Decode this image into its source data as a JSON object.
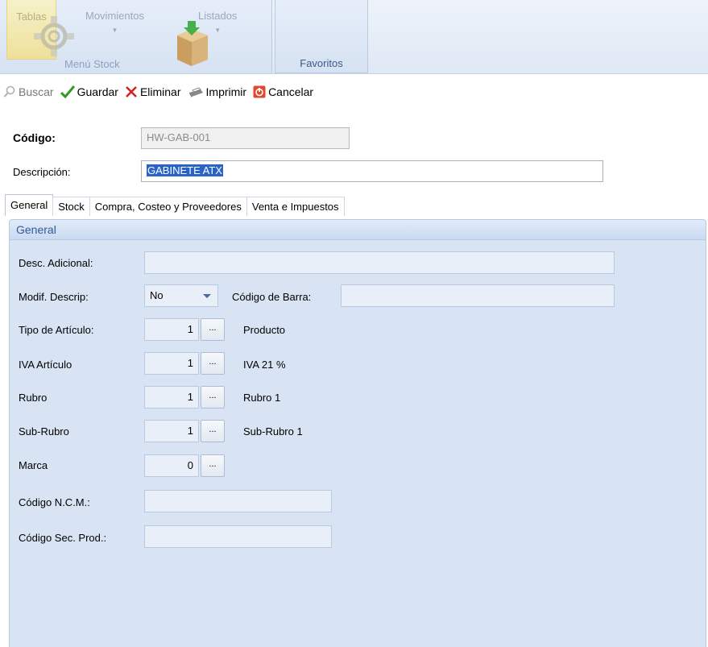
{
  "ribbon": {
    "tablas_label": "Tablas",
    "movimientos_label": "Movimientos",
    "listados_label": "Listados",
    "group_stock_caption": "Menú Stock",
    "group_favoritos_caption": "Favoritos"
  },
  "toolbar": {
    "buscar": "Buscar",
    "guardar": "Guardar",
    "eliminar": "Eliminar",
    "imprimir": "Imprimir",
    "cancelar": "Cancelar"
  },
  "header": {
    "codigo_label": "Código:",
    "codigo_value": "HW-GAB-001",
    "descripcion_label": "Descripción:",
    "descripcion_value": "GABINETE ATX"
  },
  "tabs": [
    {
      "label": "General"
    },
    {
      "label": "Stock"
    },
    {
      "label": "Compra, Costeo y Proveedores"
    },
    {
      "label": "Venta e Impuestos"
    }
  ],
  "panel": {
    "title": "General",
    "desc_adicional_label": "Desc. Adicional:",
    "desc_adicional_value": "",
    "modif_descrip_label": "Modif. Descrip:",
    "modif_descrip_value": "No",
    "codigo_barra_label": "Código de Barra:",
    "codigo_barra_value": "",
    "tipo_articulo_label": "Tipo de Artículo:",
    "tipo_articulo_code": "1",
    "tipo_articulo_desc": "Producto",
    "iva_label": "IVA Artículo",
    "iva_code": "1",
    "iva_desc": "IVA 21 %",
    "rubro_label": "Rubro",
    "rubro_code": "1",
    "rubro_desc": "Rubro 1",
    "subrubro_label": "Sub-Rubro",
    "subrubro_code": "1",
    "subrubro_desc": "Sub-Rubro 1",
    "marca_label": "Marca",
    "marca_code": "0",
    "ncm_label": "Código N.C.M.:",
    "ncm_value": "",
    "sec_prod_label": "Código Sec. Prod.:",
    "sec_prod_value": "",
    "lookup_button": "..."
  }
}
